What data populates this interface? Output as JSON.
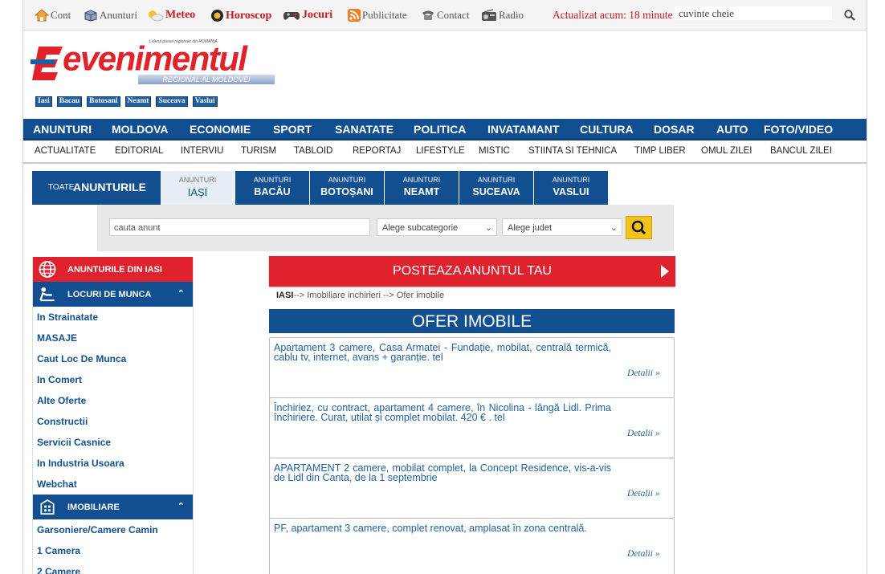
{
  "topbar": {
    "links": [
      {
        "label": "Cont",
        "icon": "home-icon"
      },
      {
        "label": "Anunturi",
        "icon": "box-icon"
      },
      {
        "label": "Meteo",
        "icon": "sun-cloud-icon"
      },
      {
        "label": "Horoscop",
        "icon": "horoscope-icon"
      },
      {
        "label": "Jocuri",
        "icon": "gamepad-icon"
      },
      {
        "label": "Publicitate",
        "icon": "rss-icon"
      },
      {
        "label": "Contact",
        "icon": "phone-icon"
      },
      {
        "label": "Radio",
        "icon": "radio-icon"
      }
    ],
    "updated": "Actualizat acum: 18 minute",
    "search_value": "cuvinte cheie"
  },
  "logo": {
    "word": "evenimentul",
    "tagline": "Liderul presei regionale din ROMANIA",
    "subtitle": "REGIONAL AL MOLDOVEI",
    "cities": [
      "Iasi",
      "Bacau",
      "Botosani",
      "Neamt",
      "Suceava",
      "Vaslui"
    ]
  },
  "nav": {
    "main": [
      "ANUNTURI",
      "MOLDOVA",
      "ECONOMIE",
      "SPORT",
      "SANATATE",
      "POLITICA",
      "INVATAMANT",
      "CULTURA",
      "DOSAR",
      "AUTO",
      "FOTO/VIDEO"
    ],
    "sub": [
      "ACTUALITATE",
      "EDITORIAL",
      "INTERVIU",
      "TURISM",
      "TABLOID",
      "REPORTAJ",
      "LIFESTYLE",
      "MISTIC",
      "STIINTA SI TEHNICA",
      "TIMP LIBER",
      "OMUL ZILEI",
      "BANCUL ZILEI"
    ]
  },
  "tabs": {
    "all_prefix": "TOATE",
    "all_label": "ANUNTURILE",
    "city_prefix": "ANUNTURI",
    "cities": [
      "IAȘI",
      "BACĂU",
      "BOTOȘANI",
      "NEAMT",
      "SUCEAVA",
      "VASLUI"
    ]
  },
  "filter": {
    "search_value": "cauta anunt",
    "subcategory": "Alege subcategorie",
    "county": "Alege judet"
  },
  "sidebar": {
    "header": "ANUNTURILE DIN IASI",
    "sections": [
      {
        "title": "LOCURI DE MUNCA",
        "items": [
          "In Strainatate",
          "MASAJE",
          "Caut Loc De Munca",
          "In Comert",
          "Alte Oferte",
          "Constructii",
          "Servicii Casnice",
          "In Industria Usoara",
          "Webchat"
        ]
      },
      {
        "title": "IMOBILIARE",
        "items": [
          "Garsoniere/Camere Camin",
          "1 Camera",
          "2 Camere"
        ]
      }
    ]
  },
  "main": {
    "post_button": "POSTEAZA ANUNTUL TAU",
    "breadcrumb_city": "IASI",
    "breadcrumb_rest": "--> Imobiliare inchirieri --> Ofer imobile",
    "heading": "OFER IMOBILE",
    "details_label": "Detalii »",
    "ads": [
      "Apartament 3 camere, Casa Armatei - Fundație, mobilat, centrală termică, cablu tv, internet, avans + garanție. tel",
      "Închiriez, cu contract, apartament 4 camere, în Nicolina - lângă Lidl. Prima închiriere. Curat, utilat și complet mobilat. 420 € . tel",
      "APARTAMENT 2 camere, mobilat complet, la Concept Residence, vis-a-vis de Lidl din Canta, de la 1 septembrie",
      "PF, apartament 3 camere, complet renovat, amplasat în zona centrală."
    ]
  },
  "colors": {
    "brand_blue": "#124f91",
    "brand_red": "#e0212e",
    "accent_yellow": "#f4c21a"
  }
}
